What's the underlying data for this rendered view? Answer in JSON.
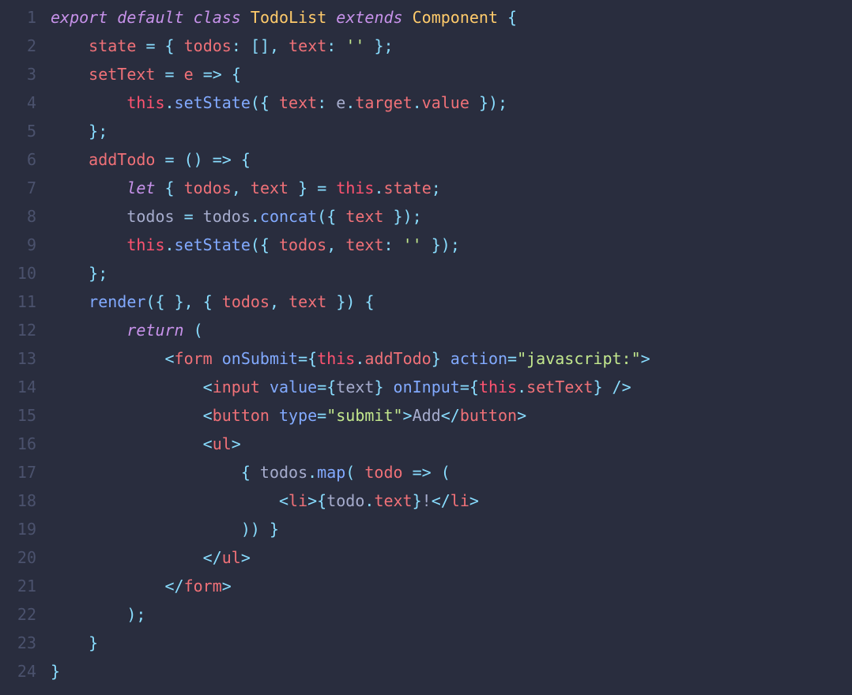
{
  "theme": {
    "background": "#292d3e",
    "foreground": "#a6accd",
    "gutter": "#4b526d",
    "keyword": "#c792ea",
    "class": "#ffcb6b",
    "function": "#82aaff",
    "property": "#f07178",
    "this": "#ff5370",
    "operator": "#89ddff",
    "string": "#c3e88d"
  },
  "language": "jsx",
  "line_count": 24,
  "lines": [
    [
      [
        "kw",
        "export"
      ],
      [
        "plain",
        " "
      ],
      [
        "kw",
        "default"
      ],
      [
        "plain",
        " "
      ],
      [
        "kw",
        "class"
      ],
      [
        "plain",
        " "
      ],
      [
        "cls",
        "TodoList"
      ],
      [
        "plain",
        " "
      ],
      [
        "kw",
        "extends"
      ],
      [
        "plain",
        " "
      ],
      [
        "cls",
        "Component"
      ],
      [
        "plain",
        " "
      ],
      [
        "op",
        "{"
      ]
    ],
    [
      [
        "plain",
        "    "
      ],
      [
        "prop",
        "state"
      ],
      [
        "plain",
        " "
      ],
      [
        "op",
        "="
      ],
      [
        "plain",
        " "
      ],
      [
        "op",
        "{"
      ],
      [
        "plain",
        " "
      ],
      [
        "prop",
        "todos"
      ],
      [
        "op",
        ":"
      ],
      [
        "plain",
        " "
      ],
      [
        "op",
        "[],"
      ],
      [
        "plain",
        " "
      ],
      [
        "prop",
        "text"
      ],
      [
        "op",
        ":"
      ],
      [
        "plain",
        " "
      ],
      [
        "str",
        "''"
      ],
      [
        "plain",
        " "
      ],
      [
        "op",
        "};"
      ]
    ],
    [
      [
        "plain",
        "    "
      ],
      [
        "prop",
        "setText"
      ],
      [
        "plain",
        " "
      ],
      [
        "op",
        "="
      ],
      [
        "plain",
        " "
      ],
      [
        "prop",
        "e"
      ],
      [
        "plain",
        " "
      ],
      [
        "op",
        "=>"
      ],
      [
        "plain",
        " "
      ],
      [
        "op",
        "{"
      ]
    ],
    [
      [
        "plain",
        "        "
      ],
      [
        "this",
        "this"
      ],
      [
        "op",
        "."
      ],
      [
        "fn",
        "setState"
      ],
      [
        "op",
        "({"
      ],
      [
        "plain",
        " "
      ],
      [
        "prop",
        "text"
      ],
      [
        "op",
        ":"
      ],
      [
        "plain",
        " "
      ],
      [
        "plain",
        "e"
      ],
      [
        "op",
        "."
      ],
      [
        "prop",
        "target"
      ],
      [
        "op",
        "."
      ],
      [
        "prop",
        "value"
      ],
      [
        "plain",
        " "
      ],
      [
        "op",
        "});"
      ]
    ],
    [
      [
        "plain",
        "    "
      ],
      [
        "op",
        "};"
      ]
    ],
    [
      [
        "plain",
        "    "
      ],
      [
        "prop",
        "addTodo"
      ],
      [
        "plain",
        " "
      ],
      [
        "op",
        "="
      ],
      [
        "plain",
        " "
      ],
      [
        "op",
        "()"
      ],
      [
        "plain",
        " "
      ],
      [
        "op",
        "=>"
      ],
      [
        "plain",
        " "
      ],
      [
        "op",
        "{"
      ]
    ],
    [
      [
        "plain",
        "        "
      ],
      [
        "kw",
        "let"
      ],
      [
        "plain",
        " "
      ],
      [
        "op",
        "{"
      ],
      [
        "plain",
        " "
      ],
      [
        "prop",
        "todos"
      ],
      [
        "op",
        ","
      ],
      [
        "plain",
        " "
      ],
      [
        "prop",
        "text"
      ],
      [
        "plain",
        " "
      ],
      [
        "op",
        "}"
      ],
      [
        "plain",
        " "
      ],
      [
        "op",
        "="
      ],
      [
        "plain",
        " "
      ],
      [
        "this",
        "this"
      ],
      [
        "op",
        "."
      ],
      [
        "prop",
        "state"
      ],
      [
        "op",
        ";"
      ]
    ],
    [
      [
        "plain",
        "        "
      ],
      [
        "plain",
        "todos "
      ],
      [
        "op",
        "="
      ],
      [
        "plain",
        " todos"
      ],
      [
        "op",
        "."
      ],
      [
        "fn",
        "concat"
      ],
      [
        "op",
        "({"
      ],
      [
        "plain",
        " "
      ],
      [
        "prop",
        "text"
      ],
      [
        "plain",
        " "
      ],
      [
        "op",
        "});"
      ]
    ],
    [
      [
        "plain",
        "        "
      ],
      [
        "this",
        "this"
      ],
      [
        "op",
        "."
      ],
      [
        "fn",
        "setState"
      ],
      [
        "op",
        "({"
      ],
      [
        "plain",
        " "
      ],
      [
        "prop",
        "todos"
      ],
      [
        "op",
        ","
      ],
      [
        "plain",
        " "
      ],
      [
        "prop",
        "text"
      ],
      [
        "op",
        ":"
      ],
      [
        "plain",
        " "
      ],
      [
        "str",
        "''"
      ],
      [
        "plain",
        " "
      ],
      [
        "op",
        "});"
      ]
    ],
    [
      [
        "plain",
        "    "
      ],
      [
        "op",
        "};"
      ]
    ],
    [
      [
        "plain",
        "    "
      ],
      [
        "fn",
        "render"
      ],
      [
        "op",
        "({"
      ],
      [
        "plain",
        " "
      ],
      [
        "op",
        "},"
      ],
      [
        "plain",
        " "
      ],
      [
        "op",
        "{"
      ],
      [
        "plain",
        " "
      ],
      [
        "prop",
        "todos"
      ],
      [
        "op",
        ","
      ],
      [
        "plain",
        " "
      ],
      [
        "prop",
        "text"
      ],
      [
        "plain",
        " "
      ],
      [
        "op",
        "})"
      ],
      [
        "plain",
        " "
      ],
      [
        "op",
        "{"
      ]
    ],
    [
      [
        "plain",
        "        "
      ],
      [
        "kw",
        "return"
      ],
      [
        "plain",
        " "
      ],
      [
        "op",
        "("
      ]
    ],
    [
      [
        "plain",
        "            "
      ],
      [
        "op",
        "<"
      ],
      [
        "prop",
        "form"
      ],
      [
        "plain",
        " "
      ],
      [
        "fn",
        "onSubmit"
      ],
      [
        "op",
        "={"
      ],
      [
        "this",
        "this"
      ],
      [
        "op",
        "."
      ],
      [
        "prop",
        "addTodo"
      ],
      [
        "op",
        "}"
      ],
      [
        "plain",
        " "
      ],
      [
        "fn",
        "action"
      ],
      [
        "op",
        "="
      ],
      [
        "str",
        "\"javascript:\""
      ],
      [
        "op",
        ">"
      ]
    ],
    [
      [
        "plain",
        "                "
      ],
      [
        "op",
        "<"
      ],
      [
        "prop",
        "input"
      ],
      [
        "plain",
        " "
      ],
      [
        "fn",
        "value"
      ],
      [
        "op",
        "={"
      ],
      [
        "plain",
        "text"
      ],
      [
        "op",
        "}"
      ],
      [
        "plain",
        " "
      ],
      [
        "fn",
        "onInput"
      ],
      [
        "op",
        "={"
      ],
      [
        "this",
        "this"
      ],
      [
        "op",
        "."
      ],
      [
        "prop",
        "setText"
      ],
      [
        "op",
        "}"
      ],
      [
        "plain",
        " "
      ],
      [
        "op",
        "/>"
      ]
    ],
    [
      [
        "plain",
        "                "
      ],
      [
        "op",
        "<"
      ],
      [
        "prop",
        "button"
      ],
      [
        "plain",
        " "
      ],
      [
        "fn",
        "type"
      ],
      [
        "op",
        "="
      ],
      [
        "str",
        "\"submit\""
      ],
      [
        "op",
        ">"
      ],
      [
        "plain",
        "Add"
      ],
      [
        "op",
        "</"
      ],
      [
        "prop",
        "button"
      ],
      [
        "op",
        ">"
      ]
    ],
    [
      [
        "plain",
        "                "
      ],
      [
        "op",
        "<"
      ],
      [
        "prop",
        "ul"
      ],
      [
        "op",
        ">"
      ]
    ],
    [
      [
        "plain",
        "                    "
      ],
      [
        "op",
        "{"
      ],
      [
        "plain",
        " todos"
      ],
      [
        "op",
        "."
      ],
      [
        "fn",
        "map"
      ],
      [
        "op",
        "("
      ],
      [
        "plain",
        " "
      ],
      [
        "prop",
        "todo"
      ],
      [
        "plain",
        " "
      ],
      [
        "op",
        "=>"
      ],
      [
        "plain",
        " "
      ],
      [
        "op",
        "("
      ]
    ],
    [
      [
        "plain",
        "                        "
      ],
      [
        "op",
        "<"
      ],
      [
        "prop",
        "li"
      ],
      [
        "op",
        ">{"
      ],
      [
        "plain",
        "todo"
      ],
      [
        "op",
        "."
      ],
      [
        "prop",
        "text"
      ],
      [
        "op",
        "}"
      ],
      [
        "plain",
        "!"
      ],
      [
        "op",
        "</"
      ],
      [
        "prop",
        "li"
      ],
      [
        "op",
        ">"
      ]
    ],
    [
      [
        "plain",
        "                    "
      ],
      [
        "op",
        "))"
      ],
      [
        "plain",
        " "
      ],
      [
        "op",
        "}"
      ]
    ],
    [
      [
        "plain",
        "                "
      ],
      [
        "op",
        "</"
      ],
      [
        "prop",
        "ul"
      ],
      [
        "op",
        ">"
      ]
    ],
    [
      [
        "plain",
        "            "
      ],
      [
        "op",
        "</"
      ],
      [
        "prop",
        "form"
      ],
      [
        "op",
        ">"
      ]
    ],
    [
      [
        "plain",
        "        "
      ],
      [
        "op",
        ");"
      ]
    ],
    [
      [
        "plain",
        "    "
      ],
      [
        "op",
        "}"
      ]
    ],
    [
      [
        "op",
        "}"
      ]
    ]
  ]
}
